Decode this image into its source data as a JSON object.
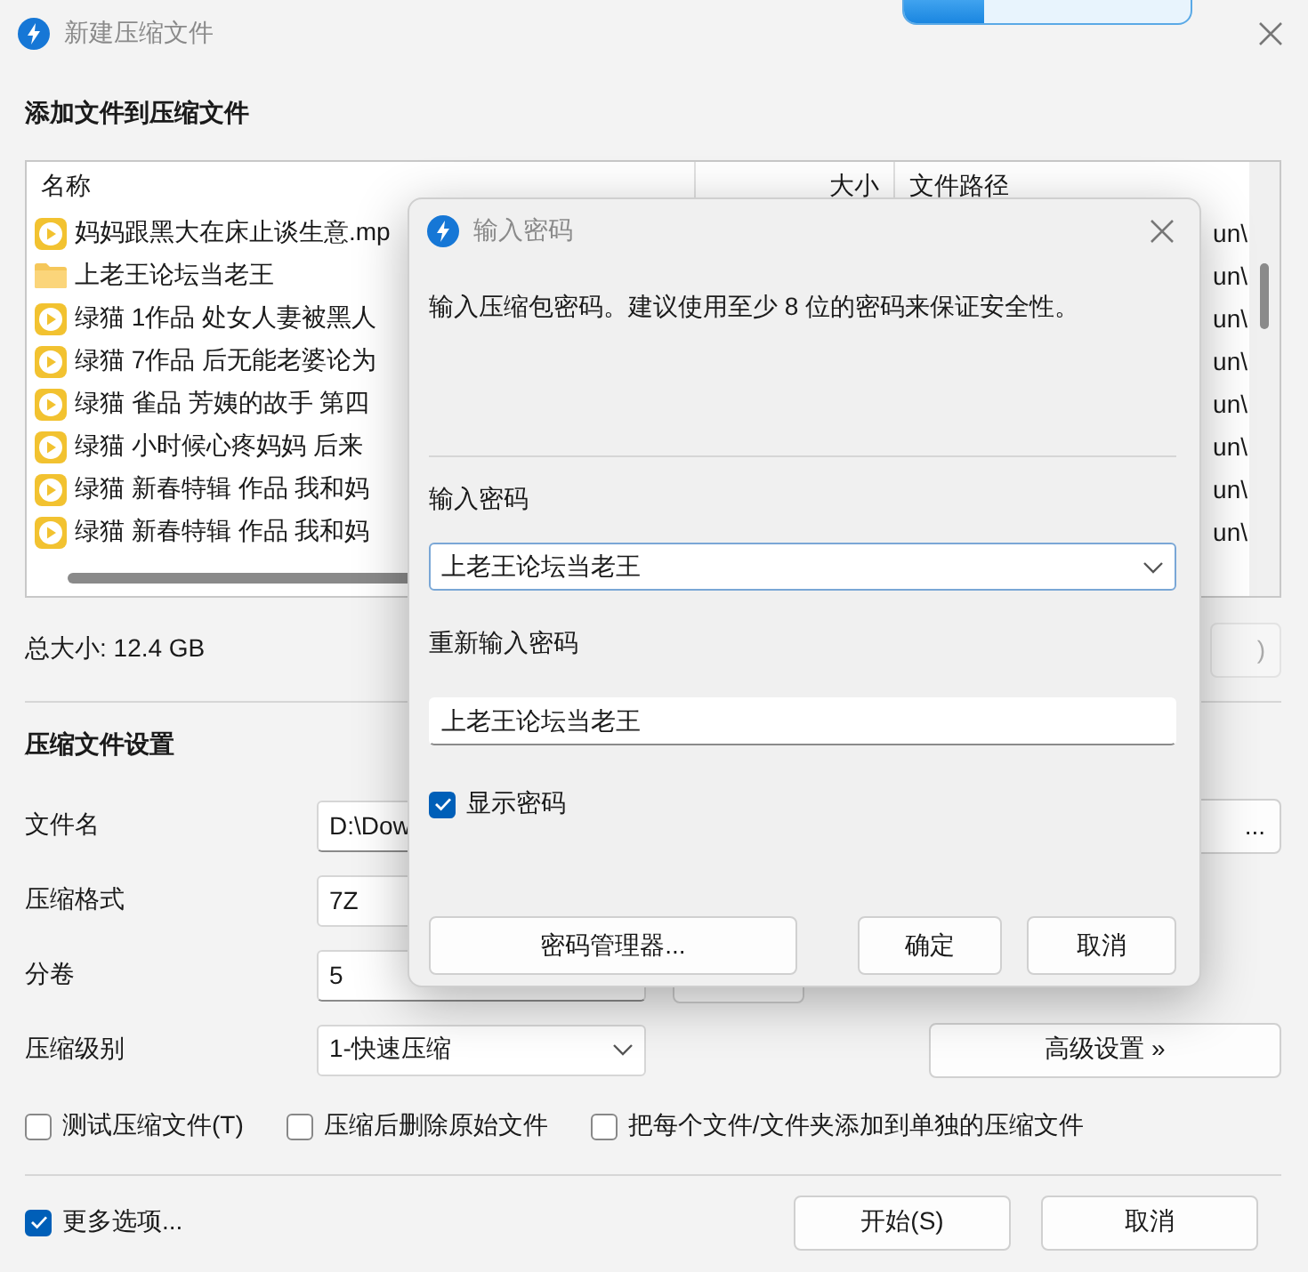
{
  "window": {
    "title": "新建压缩文件"
  },
  "overlay_progress": {
    "level": 0.28
  },
  "files": {
    "title": "添加文件到压缩文件",
    "columns": [
      "名称",
      "大小",
      "文件路径"
    ],
    "rows": [
      {
        "kind": "video",
        "name": "妈妈跟黑大在床止谈生意.mp",
        "path": "un\\"
      },
      {
        "kind": "folder",
        "name": "上老王论坛当老王",
        "path": "un\\"
      },
      {
        "kind": "video",
        "name": "绿猫 1作品 处女人妻被黑人",
        "path": "un\\"
      },
      {
        "kind": "video",
        "name": "绿猫 7作品 后无能老婆论为",
        "path": "un\\"
      },
      {
        "kind": "video",
        "name": "绿猫 雀品 芳姨的故手 第四",
        "path": "un\\"
      },
      {
        "kind": "video",
        "name": "绿猫 小时候心疼妈妈 后来",
        "path": "un\\"
      },
      {
        "kind": "video",
        "name": "绿猫 新春特辑 作品 我和妈",
        "path": "un\\"
      },
      {
        "kind": "video",
        "name": "绿猫 新春特辑 作品 我和妈",
        "path": "un\\"
      }
    ]
  },
  "total_size": "总大小: 12.4 GB",
  "total_button": ")",
  "settings": {
    "title": "压缩文件设置",
    "filename": {
      "label": "文件名",
      "value": "D:\\Dow",
      "browse": "..."
    },
    "format": {
      "label": "压缩格式",
      "value": "7Z"
    },
    "volume": {
      "label": "分卷",
      "value": "5"
    },
    "level": {
      "label": "压缩级别",
      "value": "1-快速压缩",
      "advanced": "高级设置 »"
    },
    "options": [
      {
        "label": "测试压缩文件(T)",
        "checked": false
      },
      {
        "label": "压缩后删除原始文件",
        "checked": false
      },
      {
        "label": "把每个文件/文件夹添加到单独的压缩文件",
        "checked": false
      }
    ]
  },
  "more_options": {
    "label": "更多选项...",
    "checked": true
  },
  "buttons": [
    "开始(S)",
    "取消"
  ],
  "dialog": {
    "title": "输入密码",
    "description": "输入压缩包密码。建议使用至少 8 位的密码来保证安全性。",
    "password_label": "输入密码",
    "password_value": "上老王论坛当老王",
    "confirm_label": "重新输入密码",
    "confirm_value": "上老王论坛当老王",
    "show_password": {
      "label": "显示密码",
      "checked": true
    },
    "buttons": [
      "密码管理器...",
      "确定",
      "取消"
    ]
  }
}
